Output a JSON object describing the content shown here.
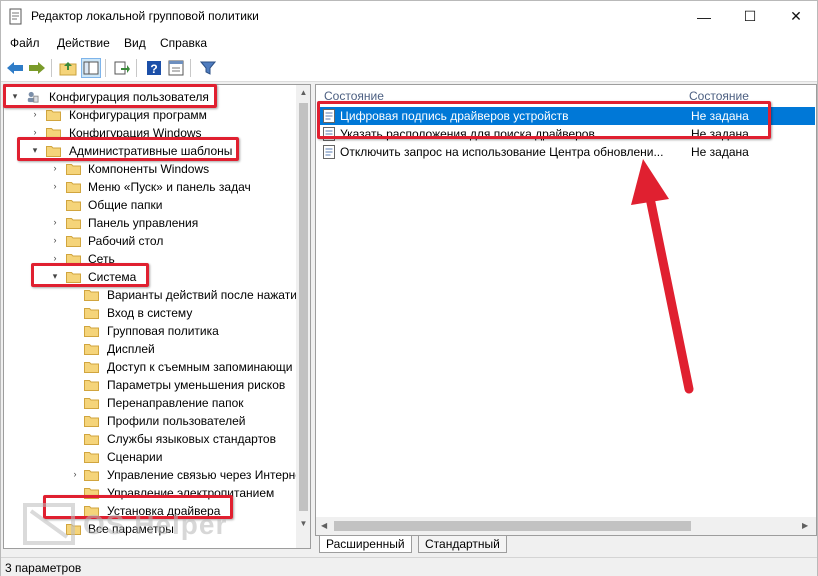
{
  "window": {
    "title": "Редактор локальной групповой политики",
    "controls": {
      "minimize": "—",
      "maximize": "☐",
      "close": "✕"
    }
  },
  "menu": [
    "Файл",
    "Действие",
    "Вид",
    "Справка"
  ],
  "toolbar": {
    "buttons": [
      "back-arrow-icon",
      "forward-arrow-icon",
      "up-folder-icon",
      "show-tree-icon",
      "export-icon",
      "help-icon",
      "properties-icon",
      "filter-icon"
    ]
  },
  "tree": [
    {
      "label": "Конфигурация пользователя",
      "expander": "▾",
      "icon": "user-config-icon"
    },
    {
      "label": "Конфигурация программ",
      "expander": "›",
      "icon": "folder-icon"
    },
    {
      "label": "Конфигурация Windows",
      "expander": "›",
      "icon": "folder-icon"
    },
    {
      "label": "Административные шаблоны",
      "expander": "▾",
      "icon": "folder-icon"
    },
    {
      "label": "Компоненты Windows",
      "expander": "›",
      "icon": "folder-icon"
    },
    {
      "label": "Меню «Пуск» и панель задач",
      "expander": "›",
      "icon": "folder-icon"
    },
    {
      "label": "Общие папки",
      "expander": "",
      "icon": "folder-icon"
    },
    {
      "label": "Панель управления",
      "expander": "›",
      "icon": "folder-icon"
    },
    {
      "label": "Рабочий стол",
      "expander": "›",
      "icon": "folder-icon"
    },
    {
      "label": "Сеть",
      "expander": "›",
      "icon": "folder-icon"
    },
    {
      "label": "Система",
      "expander": "▾",
      "icon": "folder-icon"
    },
    {
      "label": "Варианты действий после нажатия",
      "expander": "",
      "icon": "folder-icon"
    },
    {
      "label": "Вход в систему",
      "expander": "",
      "icon": "folder-icon"
    },
    {
      "label": "Групповая политика",
      "expander": "",
      "icon": "folder-icon"
    },
    {
      "label": "Дисплей",
      "expander": "",
      "icon": "folder-icon"
    },
    {
      "label": "Доступ к съемным запоминающи",
      "expander": "",
      "icon": "folder-icon"
    },
    {
      "label": "Параметры уменьшения рисков",
      "expander": "",
      "icon": "folder-icon"
    },
    {
      "label": "Перенаправление папок",
      "expander": "",
      "icon": "folder-icon"
    },
    {
      "label": "Профили пользователей",
      "expander": "",
      "icon": "folder-icon"
    },
    {
      "label": "Службы языковых стандартов",
      "expander": "",
      "icon": "folder-icon"
    },
    {
      "label": "Сценарии",
      "expander": "",
      "icon": "folder-icon"
    },
    {
      "label": "Управление связью через Интерне",
      "expander": "›",
      "icon": "folder-icon"
    },
    {
      "label": "Управление электропитанием",
      "expander": "",
      "icon": "folder-icon"
    },
    {
      "label": "Установка драйвера",
      "expander": "",
      "icon": "folder-icon"
    },
    {
      "label": "Все параметры",
      "expander": "",
      "icon": "folder-icon"
    }
  ],
  "list": {
    "columns": {
      "name": "Состояние",
      "state": "Состояние"
    },
    "rows": [
      {
        "name": "Цифровая подпись драйверов устройств",
        "state": "Не задана",
        "selected": true
      },
      {
        "name": "Указать расположения для поиска драйверов",
        "state": "Не задана",
        "selected": false
      },
      {
        "name": "Отключить запрос на использование Центра обновлени...",
        "state": "Не задана",
        "selected": false
      }
    ]
  },
  "tabs": [
    "Расширенный",
    "Стандартный"
  ],
  "status": "3 параметров",
  "watermark": "OS Helper",
  "colors": {
    "accent": "#0078d7",
    "highlight": "#e02030",
    "folder": "#f5d47a"
  }
}
